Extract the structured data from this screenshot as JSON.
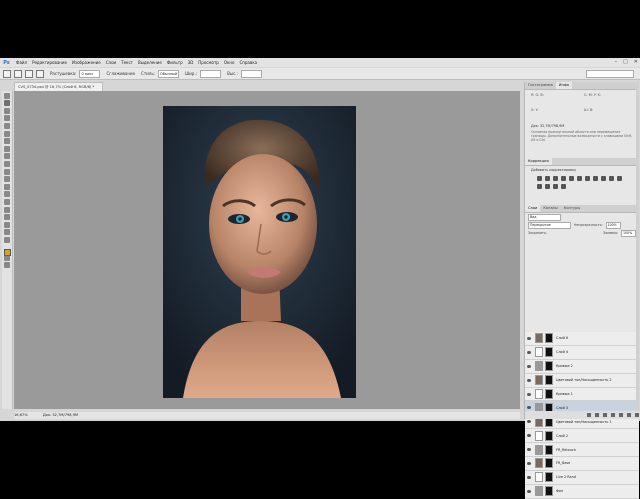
{
  "app": {
    "logo": "Ps"
  },
  "menu": [
    "Файл",
    "Редактирование",
    "Изображение",
    "Слои",
    "Текст",
    "Выделение",
    "Фильтр",
    "3D",
    "Просмотр",
    "Окно",
    "Справка"
  ],
  "window_controls": [
    "–",
    "□",
    "✕"
  ],
  "options": {
    "feather_label": "Растушевка:",
    "feather_value": "0 пикс",
    "smooth_label": "Сглаживание",
    "style_label": "Стиль:",
    "style_value": "Обычный",
    "width_label": "Шир.:",
    "height_label": "Выс.:"
  },
  "document": {
    "tab_title": "CVS_0734.psd @ 16,7% (Слой 6, RGB/8) *",
    "zoom": "16,67%",
    "doc_size": "Док: 32,7М/798,9М"
  },
  "panels": {
    "top_tabs": [
      "Гистограмма",
      "Инфо"
    ],
    "info_doc": "Док: 32,7М/798,9М",
    "info_note": "Основная прямоугольной области или перемещение границы. Дополнительные возможности с клавишами Shift, Alt и Ctrl.",
    "adj_tab": "Коррекция",
    "adj_title": "Добавить корректировку",
    "layers_tabs": [
      "Слои",
      "Каналы",
      "Контуры"
    ],
    "kind_label": "Вид",
    "blend_mode": "Перекрытие",
    "opacity_label": "Непрозрачность:",
    "opacity_value": "100%",
    "lock_label": "Закрепить:",
    "fill_label": "Заливка:",
    "fill_value": "100%"
  },
  "layers": [
    {
      "name": "Слой 6",
      "selected": false
    },
    {
      "name": "Слой 4",
      "selected": false
    },
    {
      "name": "Кривые 2",
      "selected": false
    },
    {
      "name": "Цветовой тон/Насыщенность 2",
      "selected": false
    },
    {
      "name": "Кривые 1",
      "selected": false
    },
    {
      "name": "Слой 3",
      "selected": true
    },
    {
      "name": "Цветовой тон/Насыщенность 1",
      "selected": false
    },
    {
      "name": "Слой 2",
      "selected": false
    },
    {
      "name": "FR_Retouch",
      "selected": false
    },
    {
      "name": "FR_Base",
      "selected": false
    },
    {
      "name": "Live 2 Rand",
      "selected": false
    },
    {
      "name": "Фон",
      "selected": false
    }
  ]
}
